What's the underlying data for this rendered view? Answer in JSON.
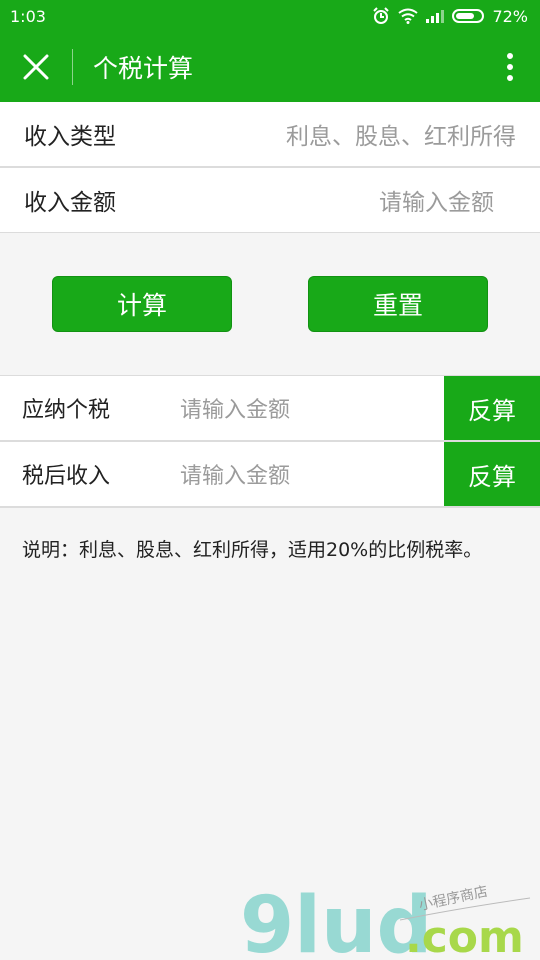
{
  "status_bar": {
    "time": "1:03",
    "battery": "72%",
    "battery_level": 0.72
  },
  "header": {
    "title": "个税计算"
  },
  "form": {
    "income_type_label": "收入类型",
    "income_type_value": "利息、股息、红利所得",
    "income_amount_label": "收入金额",
    "income_amount_placeholder": "请输入金额"
  },
  "buttons": {
    "calculate": "计算",
    "reset": "重置"
  },
  "results": [
    {
      "label": "应纳个税",
      "placeholder": "请输入金额",
      "action": "反算"
    },
    {
      "label": "税后收入",
      "placeholder": "请输入金额",
      "action": "反算"
    }
  ],
  "note": "说明：利息、股息、红利所得，适用20%的比例税率。",
  "watermark": {
    "brand": "9lud",
    "domain": ".com",
    "tagline": "小程序商店"
  }
}
